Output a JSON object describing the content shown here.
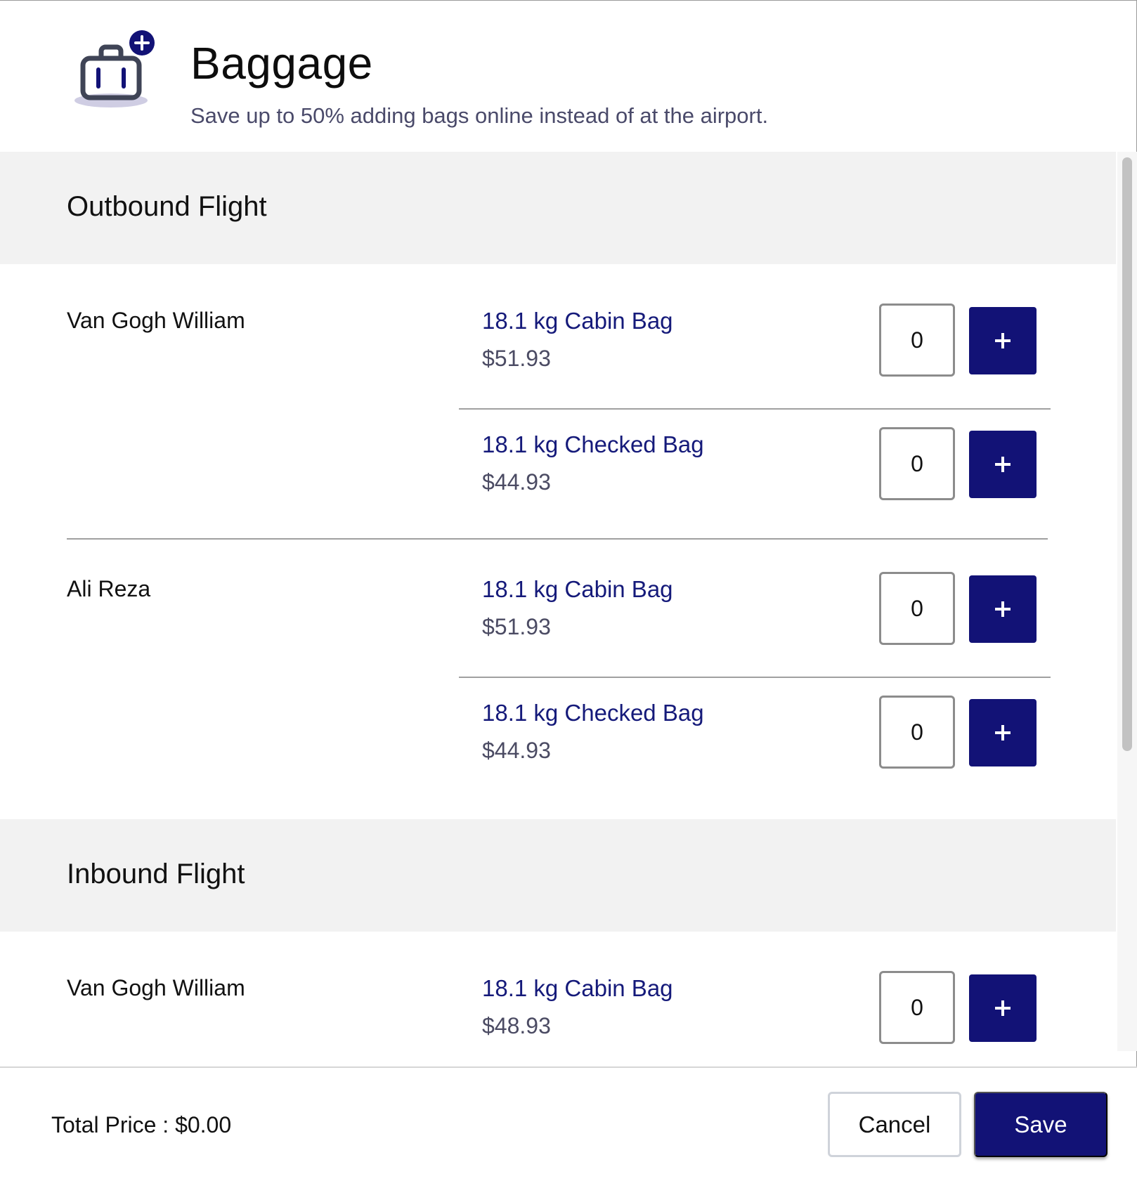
{
  "header": {
    "title": "Baggage",
    "subtitle": "Save up to 50% adding bags online instead of at the airport.",
    "icon": "baggage-add-icon"
  },
  "sections": [
    {
      "title": "Outbound Flight",
      "passengers": [
        {
          "name": "Van Gogh William",
          "bags": [
            {
              "label": "18.1 kg Cabin Bag",
              "price": "$51.93",
              "quantity": "0"
            },
            {
              "label": "18.1 kg Checked Bag",
              "price": "$44.93",
              "quantity": "0"
            }
          ]
        },
        {
          "name": "Ali Reza",
          "bags": [
            {
              "label": "18.1 kg Cabin Bag",
              "price": "$51.93",
              "quantity": "0"
            },
            {
              "label": "18.1 kg Checked Bag",
              "price": "$44.93",
              "quantity": "0"
            }
          ]
        }
      ]
    },
    {
      "title": "Inbound Flight",
      "passengers": [
        {
          "name": "Van Gogh William",
          "bags": [
            {
              "label": "18.1 kg Cabin Bag",
              "price": "$48.93",
              "quantity": "0"
            }
          ]
        }
      ]
    }
  ],
  "footer": {
    "total_label": "Total Price : $0.00",
    "cancel_label": "Cancel",
    "save_label": "Save"
  },
  "colors": {
    "accent": "#121276",
    "bag_label": "#151a7a",
    "section_bg": "#f2f2f2"
  }
}
